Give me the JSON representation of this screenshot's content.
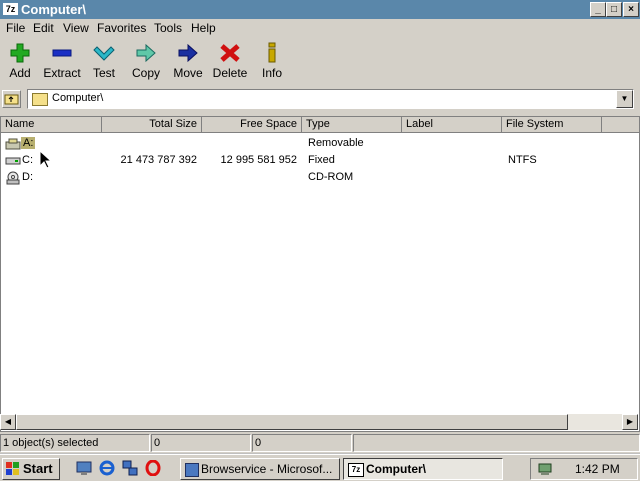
{
  "window": {
    "title": "Computer\\",
    "logo": "7z",
    "controls": [
      "_",
      "□",
      "×"
    ]
  },
  "menu": [
    "File",
    "Edit",
    "View",
    "Favorites",
    "Tools",
    "Help"
  ],
  "toolbar": [
    {
      "label": "Add",
      "icon": "plus-icon"
    },
    {
      "label": "Extract",
      "icon": "minus-icon"
    },
    {
      "label": "Test",
      "icon": "check-icon"
    },
    {
      "label": "Copy",
      "icon": "arrow-right-outline-icon"
    },
    {
      "label": "Move",
      "icon": "arrow-right-icon"
    },
    {
      "label": "Delete",
      "icon": "x-icon"
    },
    {
      "label": "Info",
      "icon": "info-icon"
    }
  ],
  "address": {
    "value": "Computer\\"
  },
  "columns": [
    "Name",
    "Total Size",
    "Free Space",
    "Type",
    "Label",
    "File System"
  ],
  "rows": [
    {
      "name": "A:",
      "total": "",
      "free": "",
      "type": "Removable",
      "label": "",
      "fs": "",
      "selected": true
    },
    {
      "name": "C:",
      "total": "21 473 787 392",
      "free": "12 995 581 952",
      "type": "Fixed",
      "label": "",
      "fs": "NTFS"
    },
    {
      "name": "D:",
      "total": "",
      "free": "",
      "type": "CD-ROM",
      "label": "",
      "fs": ""
    }
  ],
  "status": {
    "selected": "1 object(s) selected",
    "size": "0",
    "packed": "0"
  },
  "taskbar": {
    "start": "Start",
    "tasks": [
      "Browservice - Microsof...",
      "Computer\\"
    ],
    "clock": "1:42 PM"
  },
  "colors": {
    "titlebar": "#5a87aa",
    "add": "#22aa22",
    "extract": "#1a2fc4",
    "test": "#2bb8c8",
    "move": "#1a2fa0",
    "delete": "#d01010",
    "info": "#c8a800"
  }
}
